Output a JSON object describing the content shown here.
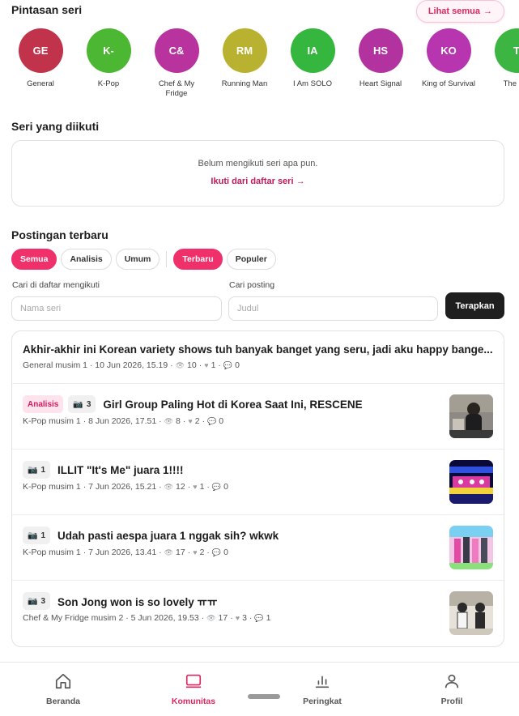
{
  "shortcut": {
    "title": "Pintasan seri",
    "see_all": "Lihat semua",
    "see_all_arrow": "→",
    "series": [
      {
        "initials": "GE",
        "label": "General",
        "color": "#c0334a"
      },
      {
        "initials": "K-",
        "label": "K-Pop",
        "color": "#4cb732"
      },
      {
        "initials": "C&",
        "label": "Chef & My Fridge",
        "color": "#b8339e"
      },
      {
        "initials": "RM",
        "label": "Running Man",
        "color": "#b9b231"
      },
      {
        "initials": "IA",
        "label": "I Am SOLO",
        "color": "#35b63f"
      },
      {
        "initials": "HS",
        "label": "Heart Signal",
        "color": "#b2339f"
      },
      {
        "initials": "KO",
        "label": "King of Survival",
        "color": "#b736b0"
      },
      {
        "initials": "T",
        "label": "The Ris",
        "color": "#3db542"
      }
    ]
  },
  "followed": {
    "title": "Seri yang diikuti",
    "empty_text": "Belum mengikuti seri apa pun.",
    "link": "Ikuti dari daftar seri →"
  },
  "posts_section": {
    "title": "Postingan terbaru",
    "type_chips": [
      "Semua",
      "Analisis",
      "Umum"
    ],
    "sort_chips": [
      "Terbaru",
      "Populer"
    ],
    "search_label": "Cari di daftar mengikuti",
    "search_placeholder": "Nama seri",
    "post_label": "Cari posting",
    "post_placeholder": "Judul",
    "apply": "Terapkan"
  },
  "posts": [
    {
      "tag": "",
      "images": "",
      "title": "Akhir-akhir ini Korean variety shows tuh banyak banget yang seru, jadi aku happy bange...",
      "meta": "General musim 1 · 10 Jun 2026, 15.19 ·",
      "views": "10",
      "likes": "1",
      "comments": "0",
      "thumb": ""
    },
    {
      "tag": "Analisis",
      "images": "3",
      "title": "Girl Group Paling Hot di Korea Saat Ini, RESCENE",
      "meta": "K-Pop musim 1 · 8 Jun 2026, 17.51 ·",
      "views": "8",
      "likes": "2",
      "comments": "0",
      "thumb": "girl"
    },
    {
      "tag": "",
      "images": "1",
      "title": "ILLIT \"It's Me\" juara 1!!!!",
      "meta": "K-Pop musim 1 · 7 Jun 2026, 15.21 ·",
      "views": "12",
      "likes": "1",
      "comments": "0",
      "thumb": "stage"
    },
    {
      "tag": "",
      "images": "1",
      "title": "Udah pasti aespa juara 1 nggak sih? wkwk",
      "meta": "K-Pop musim 1 · 7 Jun 2026, 13.41 ·",
      "views": "17",
      "likes": "2",
      "comments": "0",
      "thumb": "group"
    },
    {
      "tag": "",
      "images": "3",
      "title": "Son Jong won is so lovely ㅠㅠ",
      "meta": "Chef & My Fridge musim 2 · 5 Jun 2026, 19.53 ·",
      "views": "17",
      "likes": "3",
      "comments": "1",
      "thumb": "show"
    }
  ],
  "nav": [
    {
      "label": "Beranda",
      "icon": "home-icon",
      "active": false
    },
    {
      "label": "Komunitas",
      "icon": "community-icon",
      "active": true
    },
    {
      "label": "Peringkat",
      "icon": "ranking-icon",
      "active": false
    },
    {
      "label": "Profil",
      "icon": "profile-icon",
      "active": false
    }
  ],
  "colors": {
    "accent": "#f0306a",
    "accent_text": "#e0245e",
    "dark_button": "#1f1f1f"
  }
}
